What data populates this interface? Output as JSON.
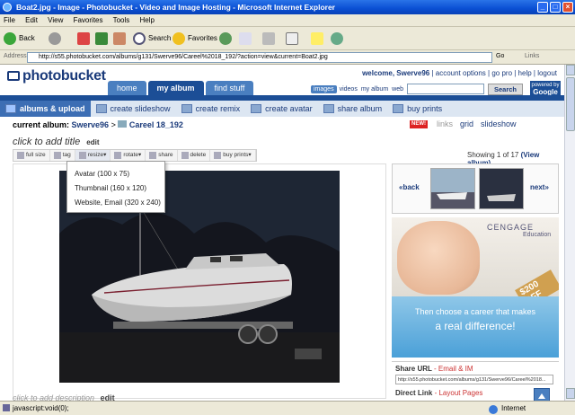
{
  "window": {
    "title": "Boat2.jpg - Image - Photobucket - Video and Image Hosting - Microsoft Internet Explorer",
    "minimize": "_",
    "maximize": "□",
    "close": "×"
  },
  "menu": [
    "File",
    "Edit",
    "View",
    "Favorites",
    "Tools",
    "Help"
  ],
  "toolbar": {
    "back": "Back",
    "search": "Search",
    "favorites": "Favorites"
  },
  "address": {
    "label": "Address",
    "url": "http://s55.photobucket.com/albums/g131/Swerve96/Careel%2018_192/?action=view&current=Boat2.jpg",
    "go": "Go",
    "links": "Links"
  },
  "site": {
    "logo": "photobucket",
    "toplinks": {
      "welcome": "welcome, Swerve96",
      "account": "account options",
      "gopro": "go pro",
      "help": "help",
      "logout": "logout"
    },
    "tabs": [
      "home",
      "my album",
      "find stuff"
    ],
    "search": {
      "scopes": [
        "images",
        "videos",
        "my album",
        "web"
      ],
      "button": "Search",
      "powered": "powered by",
      "google": "Google"
    },
    "actions": [
      "albums & upload",
      "create slideshow",
      "create remix",
      "create avatar",
      "share album",
      "buy prints"
    ]
  },
  "album": {
    "label": "current album:",
    "user": "Swerve96",
    "sep": ">",
    "name": "Careel 18_192",
    "newbadge": "NEW!",
    "view_links": "links",
    "view_grid": "grid",
    "view_slideshow": "slideshow"
  },
  "image": {
    "title_prompt": "click to add title",
    "title_edit": "edit",
    "showing": "Showing 1 of 17",
    "view_album": "(View album)",
    "tools": [
      "full size",
      "tag",
      "resize",
      "rotate",
      "share",
      "delete",
      "buy prints"
    ],
    "resize_options": [
      "Avatar (100 x 75)",
      "Thumbnail (160 x 120)",
      "Website, Email (320 x 240)"
    ],
    "description_prompt": "click to add description"
  },
  "nav": {
    "back": "back",
    "next": "next"
  },
  "ad": {
    "brand": "CENGAGE",
    "sub": "Education",
    "offer": "$200 OFF",
    "line1": "Then choose a career that makes",
    "line2": "a real difference!"
  },
  "share": {
    "url_label": "Share URL",
    "url_sub": "- Email & IM",
    "url_value": "http://s55.photobucket.com/albums/g131/Swerve96/Careel%2018...",
    "direct_label": "Direct Link",
    "direct_sub": "- Layout Pages"
  },
  "status": {
    "text": "javascript:void(0);",
    "zone": "Internet"
  }
}
